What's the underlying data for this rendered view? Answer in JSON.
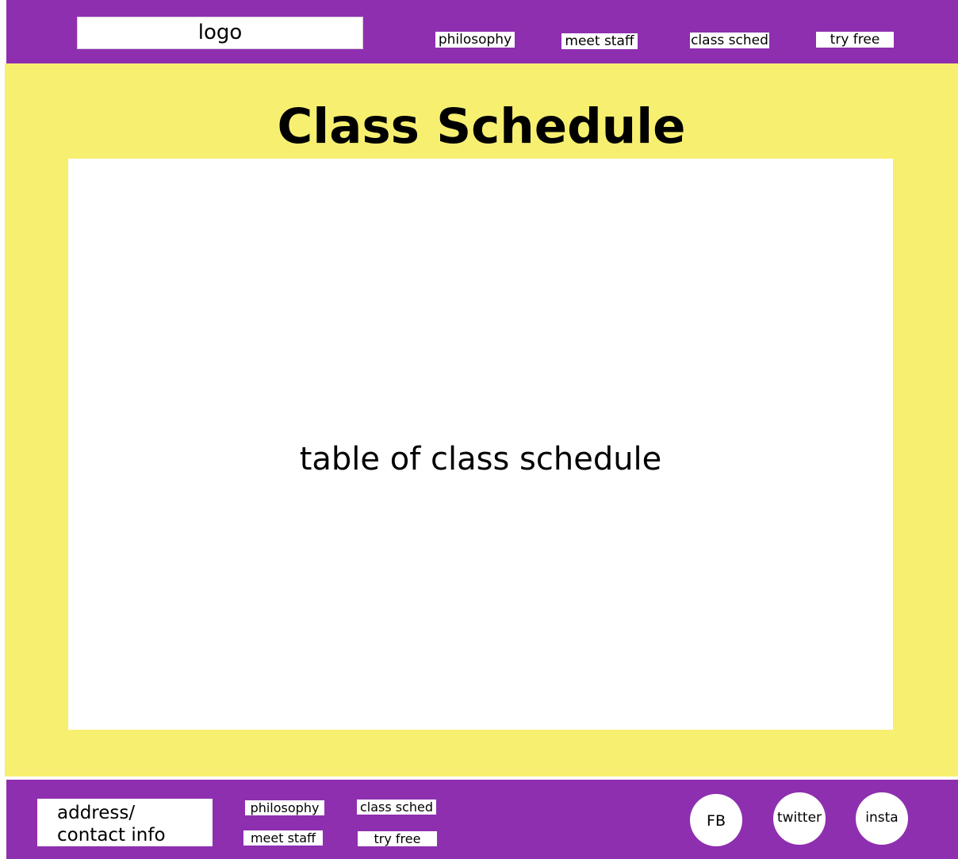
{
  "header": {
    "logo": "logo",
    "nav": {
      "philosophy": "philosophy",
      "meet_staff": "meet staff",
      "class_sched": "class sched",
      "try_free": "try free"
    }
  },
  "main": {
    "title": "Class Schedule",
    "schedule_placeholder": "table of class schedule"
  },
  "footer": {
    "contact": [
      "address/",
      "contact info"
    ],
    "links": {
      "philosophy": "philosophy",
      "class_sched": "class sched",
      "meet_staff": "meet staff",
      "try_free": "try free"
    },
    "social": {
      "fb": "FB",
      "twitter": "twitter",
      "insta": "insta"
    }
  },
  "colors": {
    "header_footer_bg": "#8e2fb0",
    "main_bg": "#f7ef70",
    "panel_bg": "#ffffff"
  }
}
